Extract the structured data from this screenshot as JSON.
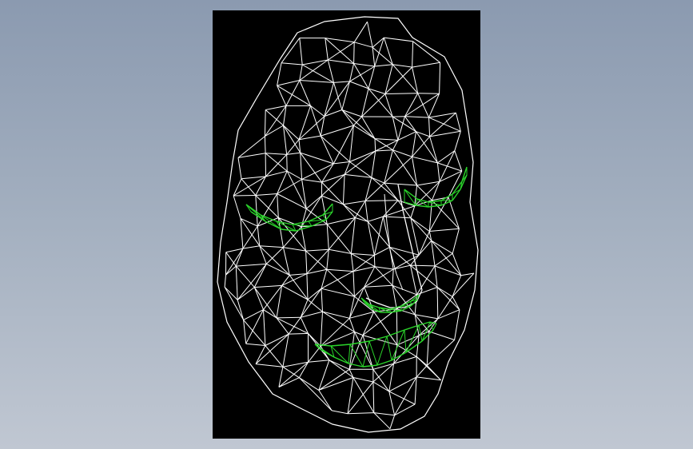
{
  "viewer": {
    "model": "face-wireframe",
    "background": "#000000",
    "colors": {
      "mesh": "#ffffff",
      "highlight": "#2bd62b",
      "window_gradient_top": "#8b9ab0",
      "window_gradient_bottom": "#c0c7d2"
    },
    "highlighted_regions": [
      "left-eye",
      "right-eye",
      "nostrils",
      "mouth"
    ]
  }
}
